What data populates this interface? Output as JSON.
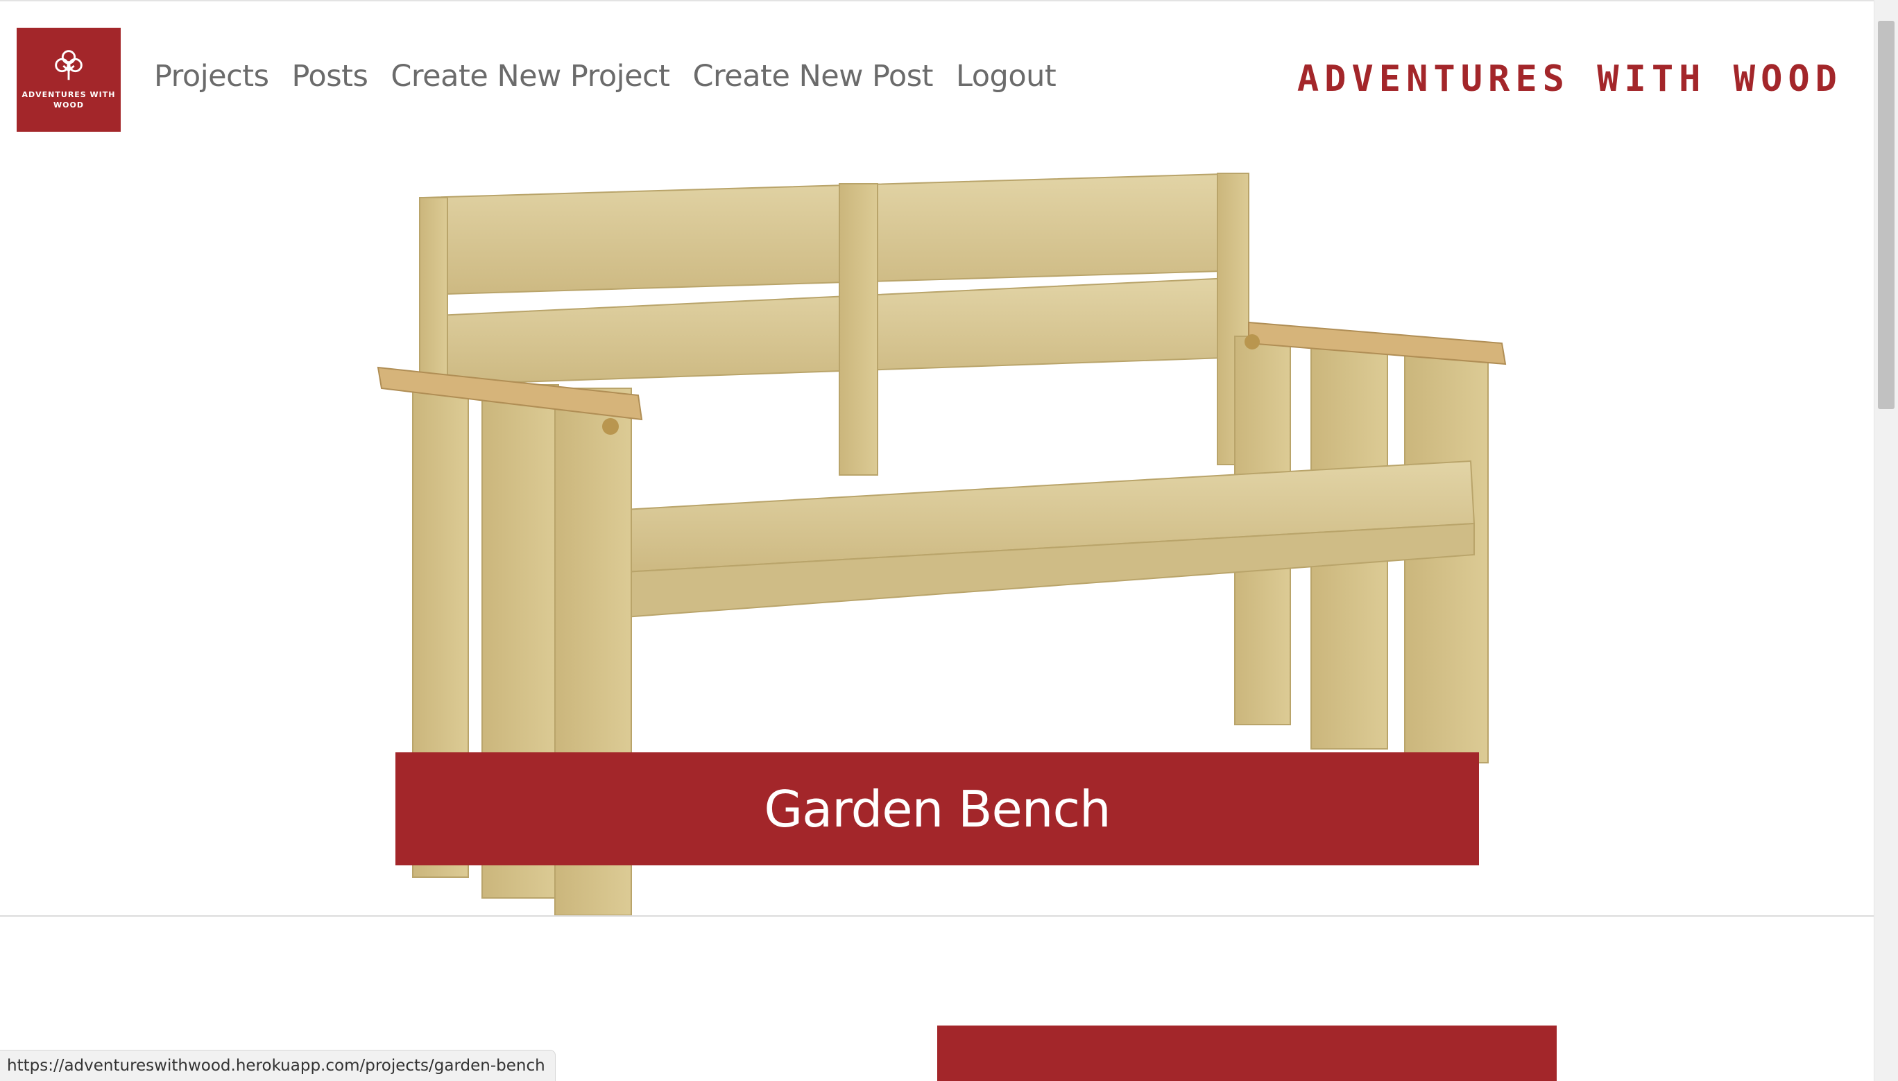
{
  "colors": {
    "brand": "#a3262a",
    "nav_text": "#6b6b6b",
    "wood": "#d8c99a"
  },
  "logo": {
    "text": "ADVENTURES WITH WOOD",
    "icon": "tree-icon"
  },
  "nav": {
    "items": [
      {
        "label": "Projects"
      },
      {
        "label": "Posts"
      },
      {
        "label": "Create New Project"
      },
      {
        "label": "Create New Post"
      },
      {
        "label": "Logout"
      }
    ]
  },
  "brand": {
    "wordmark": "ADVENTURES WITH WOOD"
  },
  "project": {
    "title": "Garden Bench",
    "image": "garden-bench-photo"
  },
  "status_bar": {
    "url": "https://adventureswithwood.herokuapp.com/projects/garden-bench"
  }
}
